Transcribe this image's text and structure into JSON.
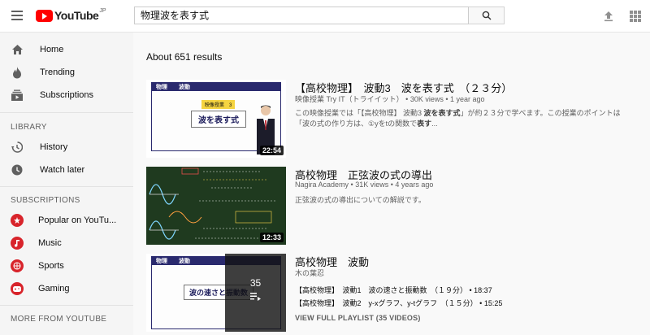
{
  "header": {
    "logo_text": "YouTube",
    "logo_region": "JP",
    "search_query": "物理波を表す式"
  },
  "sidebar": {
    "main": [
      {
        "label": "Home",
        "icon": "home-icon"
      },
      {
        "label": "Trending",
        "icon": "flame-icon"
      },
      {
        "label": "Subscriptions",
        "icon": "subscriptions-icon"
      }
    ],
    "library_heading": "LIBRARY",
    "library": [
      {
        "label": "History",
        "icon": "history-icon"
      },
      {
        "label": "Watch later",
        "icon": "clock-icon"
      }
    ],
    "subscriptions_heading": "SUBSCRIPTIONS",
    "subscriptions": [
      {
        "label": "Popular on YouTu...",
        "icon": "channel-icon"
      },
      {
        "label": "Music",
        "icon": "channel-icon"
      },
      {
        "label": "Sports",
        "icon": "channel-icon"
      },
      {
        "label": "Gaming",
        "icon": "channel-icon"
      }
    ],
    "more_heading": "MORE FROM YOUTUBE"
  },
  "results": {
    "count_text": "About 651 results",
    "items": [
      {
        "title": "【高校物理】　波動3　波を表す式　（２３分）",
        "channel": "映像授業 Try IT（トライイット）",
        "views": "30K views",
        "age": "1 year ago",
        "desc_line1_pre": "この映像授業では「【高校物理】 波動3 ",
        "desc_line1_bold": "波を表す式",
        "desc_line1_post": "」が約２３分で学べます。この授業のポイントは",
        "desc_line2_pre": "「波の式の作り方は、①yをtの関数で",
        "desc_line2_bold": "表す",
        "desc_line2_post": "...",
        "duration": "22:54",
        "thumb_tag1": "物理",
        "thumb_tag2": "波動",
        "thumb_badge": "映像授業　3",
        "thumb_title": "波を表す式"
      },
      {
        "title": "高校物理　正弦波の式の導出",
        "channel": "Nagira Academy",
        "views": "31K views",
        "age": "4 years ago",
        "desc": "正弦波の式の導出についての解説です。",
        "duration": "12:33"
      },
      {
        "title": "高校物理　波動",
        "channel": "木の葉忍",
        "playlist_count": "35",
        "playlist_items": [
          {
            "text": "【高校物理】　波動1　波の速さと振動数　（１９分）",
            "duration": "18:37"
          },
          {
            "text": "【高校物理】　波動2　y-xグラフ、y-tグラフ　（１５分）",
            "duration": "15:25"
          }
        ],
        "view_full": "VIEW FULL PLAYLIST (35 VIDEOS)",
        "thumb_tag1": "物理",
        "thumb_tag2": "波動",
        "thumb_title": "波の速さと振動数"
      }
    ]
  },
  "colors": {
    "brand_red": "#ff0000",
    "channel_red": "#d8242b",
    "thumb_dark_green": "#1f3a1f"
  }
}
